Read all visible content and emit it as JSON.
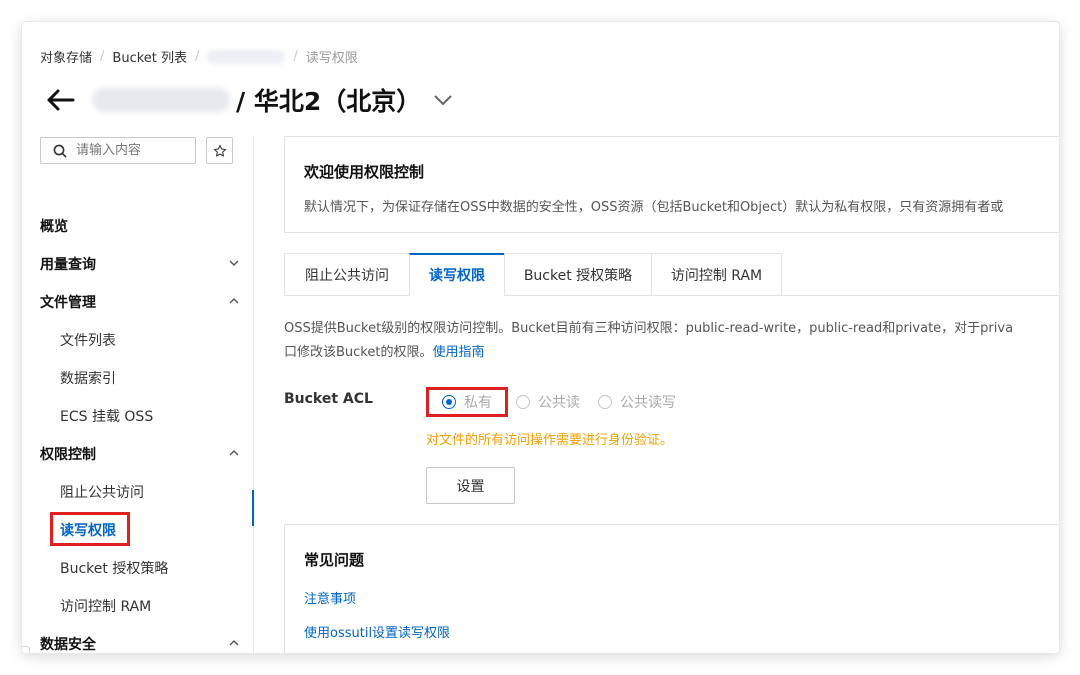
{
  "breadcrumb": {
    "items": [
      "对象存储",
      "Bucket 列表",
      "读写权限"
    ]
  },
  "header": {
    "title": "/ 华北2（北京）"
  },
  "sidebar": {
    "search_placeholder": "请输入内容",
    "items": [
      {
        "label": "概览",
        "kind": "group"
      },
      {
        "label": "用量查询",
        "kind": "group",
        "chevron": "down"
      },
      {
        "label": "文件管理",
        "kind": "group",
        "chevron": "up"
      },
      {
        "label": "文件列表",
        "kind": "sub"
      },
      {
        "label": "数据索引",
        "kind": "sub"
      },
      {
        "label": "ECS 挂载 OSS",
        "kind": "sub"
      },
      {
        "label": "权限控制",
        "kind": "group",
        "chevron": "up"
      },
      {
        "label": "阻止公共访问",
        "kind": "sub"
      },
      {
        "label": "读写权限",
        "kind": "sub",
        "active": true
      },
      {
        "label": "Bucket 授权策略",
        "kind": "sub"
      },
      {
        "label": "访问控制 RAM",
        "kind": "sub"
      },
      {
        "label": "数据安全",
        "kind": "group",
        "chevron": "up"
      }
    ]
  },
  "welcome": {
    "title": "欢迎使用权限控制",
    "description": "默认情况下，为保证存储在OSS中数据的安全性，OSS资源（包括Bucket和Object）默认为私有权限，只有资源拥有者或"
  },
  "tabs": [
    {
      "label": "阻止公共访问"
    },
    {
      "label": "读写权限",
      "active": true
    },
    {
      "label": "Bucket 授权策略"
    },
    {
      "label": "访问控制 RAM"
    }
  ],
  "intro": {
    "line1": "OSS提供Bucket级别的权限访问控制。Bucket目前有三种访问权限：public-read-write，public-read和private，对于priva",
    "line2": "口修改该Bucket的权限。",
    "link": "使用指南"
  },
  "acl": {
    "label": "Bucket ACL",
    "options": [
      {
        "label": "私有",
        "checked": true
      },
      {
        "label": "公共读",
        "checked": false
      },
      {
        "label": "公共读写",
        "checked": false
      }
    ],
    "hint": "对文件的所有访问操作需要进行身份验证。",
    "submit": "设置"
  },
  "faq": {
    "title": "常见问题",
    "links": [
      "注意事项",
      "使用ossutil设置读写权限"
    ]
  },
  "colors": {
    "accent": "#0064c8",
    "highlight": "#e02020",
    "hint": "#f0a000"
  }
}
